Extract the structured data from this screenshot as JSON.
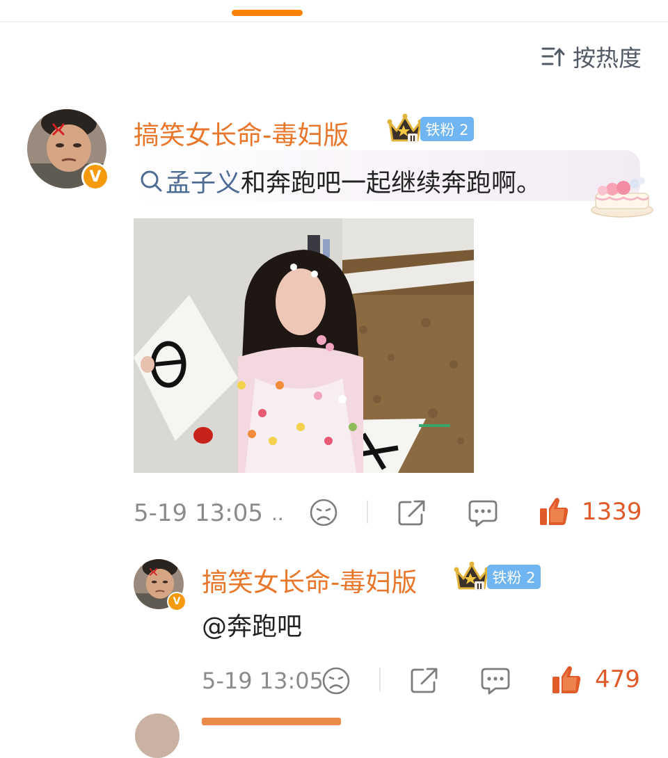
{
  "header": {
    "sort_label": "按热度",
    "accent_color": "#ff8200"
  },
  "comment": {
    "username": "搞笑女长命-毒妇版",
    "fan_badge": "铁粉 2",
    "crown_level": "II",
    "verified_badge": "V",
    "topic_link": "孟子义",
    "text": "和奔跑吧一起继续奔跑啊。",
    "time": "5-19 13:05",
    "time_ellipsis": "..",
    "like_count": "1339",
    "icons": [
      "sad-face-icon",
      "share-icon",
      "comment-icon",
      "thumbs-up-icon"
    ],
    "reply": {
      "username": "搞笑女长命-毒妇版",
      "fan_badge": "铁粉 2",
      "crown_level": "II",
      "verified_badge": "V",
      "text": "@奔跑吧",
      "time": "5-19 13:05",
      "like_count": "479"
    }
  },
  "colors": {
    "username": "#e8772c",
    "topic_link": "#4d6b94",
    "fan_badge": "#6fb5f2",
    "like": "#e05a2a",
    "verified": "#f59a0c"
  }
}
